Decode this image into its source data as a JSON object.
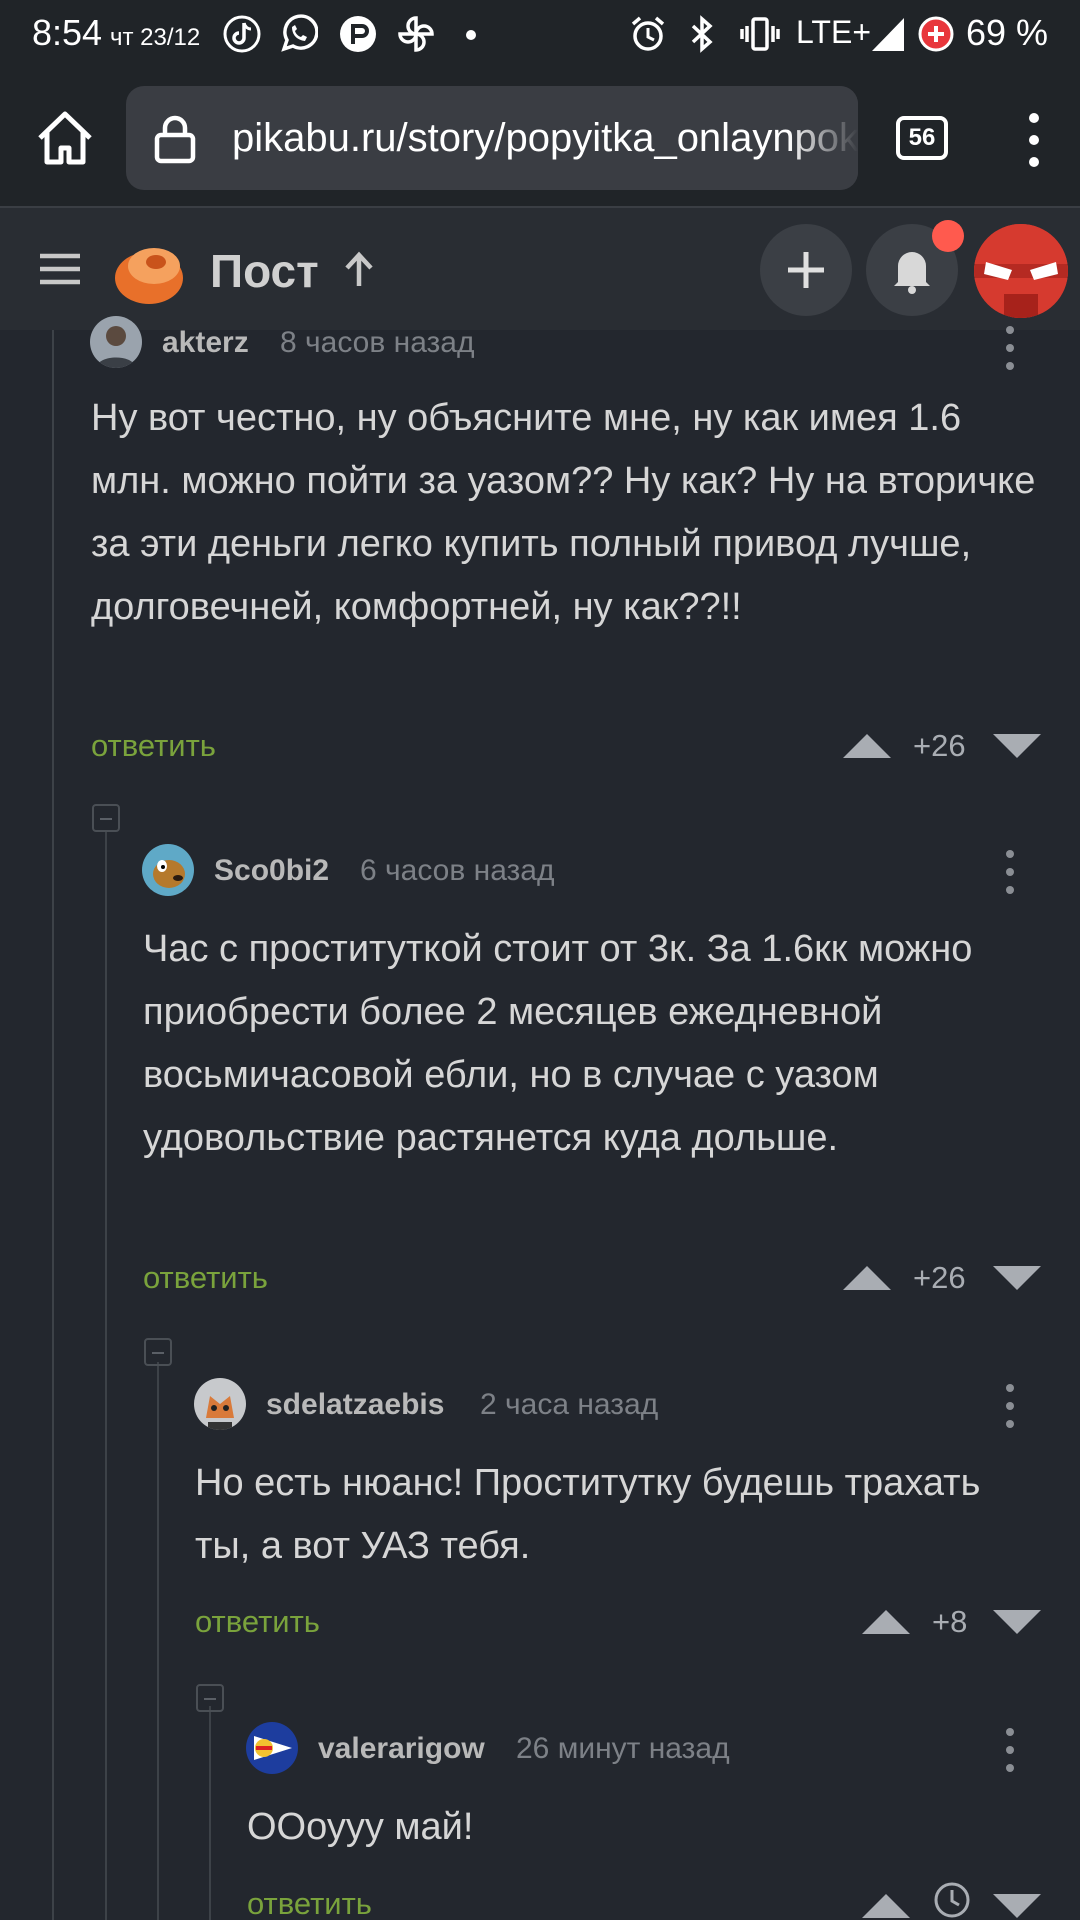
{
  "status_bar": {
    "time": "8:54",
    "date": "чт 23/12",
    "network": "LTE+",
    "battery": "69 %",
    "icons": [
      "tiktok-icon",
      "whatsapp-icon",
      "app-icon",
      "pinwheel-icon",
      "alarm-icon",
      "bluetooth-icon",
      "vibrate-icon",
      "signal-icon",
      "battery-saver-icon"
    ]
  },
  "browser": {
    "url": "pikabu.ru/story/popyitka_onlaynpok",
    "tab_count": "56"
  },
  "site_header": {
    "title": "Пост",
    "notification_color": "#ff5a4e"
  },
  "comments": [
    {
      "author": "akterz",
      "time": "8 часов назад",
      "text": "Ну вот честно, ну объясните мне, ну как имея 1.6 млн. можно пойти за уазом?? Ну как? Ну на вторичке за эти деньги легко купить полный привод лучше, долговечней, комфортней, ну как??!!",
      "reply_label": "ответить",
      "score": "+26"
    },
    {
      "author": "Sco0bi2",
      "time": "6 часов назад",
      "text": "Час с проституткой стоит от 3к. За 1.6кк можно приобрести более 2 месяцев ежедневной восьмичасовой ебли, но в случае с уазом удовольствие растянется куда дольше.",
      "reply_label": "ответить",
      "score": "+26"
    },
    {
      "author": "sdelatzaebis",
      "time": "2 часа назад",
      "text": "Но есть нюанс! Проститутку будешь трахать ты, а вот УАЗ тебя.",
      "reply_label": "ответить",
      "score": "+8"
    },
    {
      "author": "valerarigow",
      "time": "26 минут назад",
      "text": "ООоууу май!",
      "reply_label": "ответить",
      "score": ""
    }
  ],
  "colors": {
    "reply_link": "#7aa33c",
    "background": "#23272e"
  }
}
